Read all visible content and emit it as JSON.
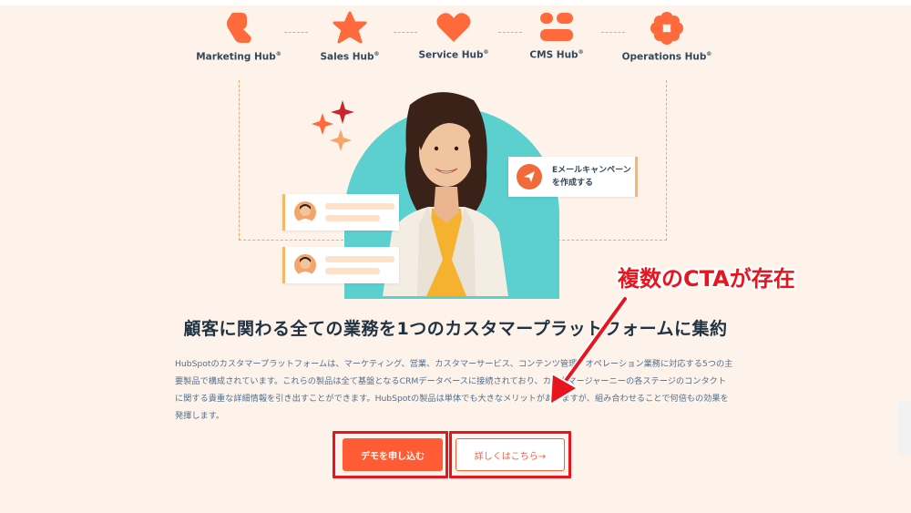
{
  "hubs": [
    {
      "name": "Marketing Hub",
      "icon": "marketing-hub-icon"
    },
    {
      "name": "Sales Hub",
      "icon": "sales-hub-icon"
    },
    {
      "name": "Service Hub",
      "icon": "service-hub-icon"
    },
    {
      "name": "CMS Hub",
      "icon": "cms-hub-icon"
    },
    {
      "name": "Operations Hub",
      "icon": "operations-hub-icon"
    }
  ],
  "hub_trademark": "®",
  "hero": {
    "email_card_text": "Eメールキャンペーンを作成する"
  },
  "annotation": {
    "label": "複数のCTAが存在"
  },
  "main": {
    "heading": "顧客に関わる全ての業務を1つのカスタマープラットフォームに集約",
    "body": "HubSpotのカスタマープラットフォームは、マーケティング、営業、カスタマーサービス、コンテンツ管理、オペレーション業務に対応する5つの主要製品で構成されています。これらの製品は全て基盤となるCRMデータベースに接続されており、カスタマージャーニーの各ステージのコンタクトに関する貴重な詳細情報を引き出すことができます。HubSpotの製品は単体でも大きなメリットがありますが、組み合わせることで何倍もの効果を発揮します。"
  },
  "cta": {
    "primary_label": "デモを申し込む",
    "secondary_label": "詳しくはこちら→"
  },
  "colors": {
    "brand_orange": "#ff5c35",
    "background": "#fdf3ea",
    "teal": "#5ccfcf",
    "annotation_red": "#e8141e"
  }
}
